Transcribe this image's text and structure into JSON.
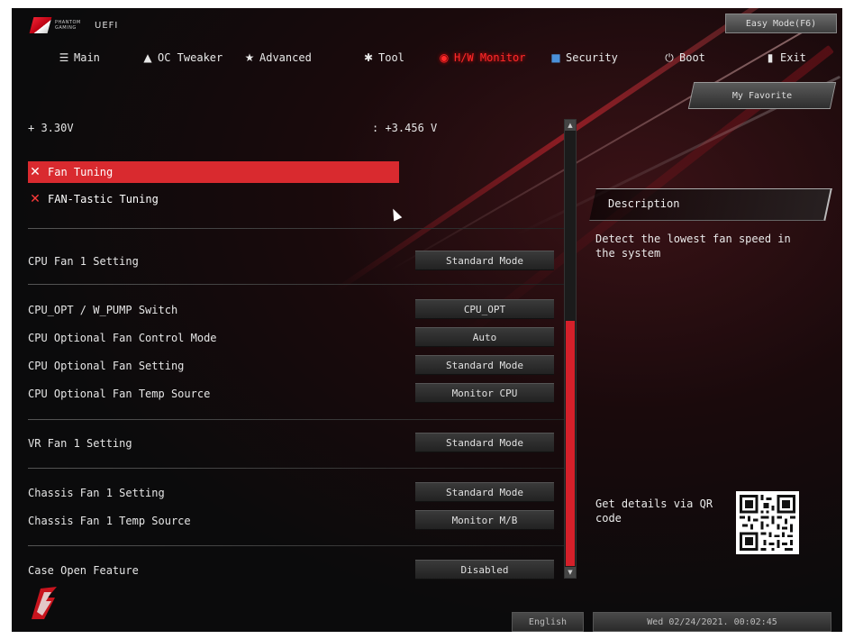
{
  "header": {
    "brand_line1": "PHANTOM",
    "brand_line2": "GAMING",
    "uefi": "UEFI",
    "easy_mode": "Easy Mode(F6)"
  },
  "nav": {
    "tabs": [
      {
        "label": "Main",
        "icon": "list-icon",
        "glyph": "☰"
      },
      {
        "label": "OC Tweaker",
        "icon": "tweaker-icon",
        "glyph": "▲"
      },
      {
        "label": "Advanced",
        "icon": "star-icon",
        "glyph": "★"
      },
      {
        "label": "Tool",
        "icon": "tool-icon",
        "glyph": "✱"
      },
      {
        "label": "H/W Monitor",
        "icon": "monitor-icon",
        "glyph": "◉"
      },
      {
        "label": "Security",
        "icon": "shield-icon",
        "glyph": "■"
      },
      {
        "label": "Boot",
        "icon": "power-icon",
        "glyph": "⏻"
      },
      {
        "label": "Exit",
        "icon": "exit-icon",
        "glyph": "▮"
      }
    ],
    "active": "H/W Monitor"
  },
  "favorite": "My Favorite",
  "list": {
    "voltage_label": "+ 3.30V",
    "voltage_value": ": +3.456 V",
    "fan_tuning": "Fan Tuning",
    "fan_tastic": "FAN-Tastic Tuning",
    "cpu_fan1_label": "CPU Fan 1 Setting",
    "cpu_fan1_value": "Standard Mode",
    "opt_switch_label": "CPU_OPT / W_PUMP Switch",
    "opt_switch_value": "CPU_OPT",
    "opt_ctrl_label": "CPU Optional Fan Control Mode",
    "opt_ctrl_value": "Auto",
    "opt_setting_label": "CPU Optional Fan Setting",
    "opt_setting_value": "Standard Mode",
    "opt_temp_label": "CPU Optional Fan Temp Source",
    "opt_temp_value": "Monitor CPU",
    "vr_fan_label": "VR Fan 1 Setting",
    "vr_fan_value": "Standard Mode",
    "chassis_fan_label": "Chassis Fan 1 Setting",
    "chassis_fan_value": "Standard Mode",
    "chassis_temp_label": "Chassis Fan 1 Temp Source",
    "chassis_temp_value": "Monitor M/B",
    "case_open_label": "Case Open Feature",
    "case_open_value": "Disabled"
  },
  "description": {
    "title": "Description",
    "text": "Detect the lowest fan speed in the system",
    "qr_text": "Get details via QR code"
  },
  "footer": {
    "language": "English",
    "datetime": "Wed 02/24/2021. 00:02:45"
  },
  "colors": {
    "accent": "#d92a2f",
    "active_tab": "#ff2a2a"
  }
}
